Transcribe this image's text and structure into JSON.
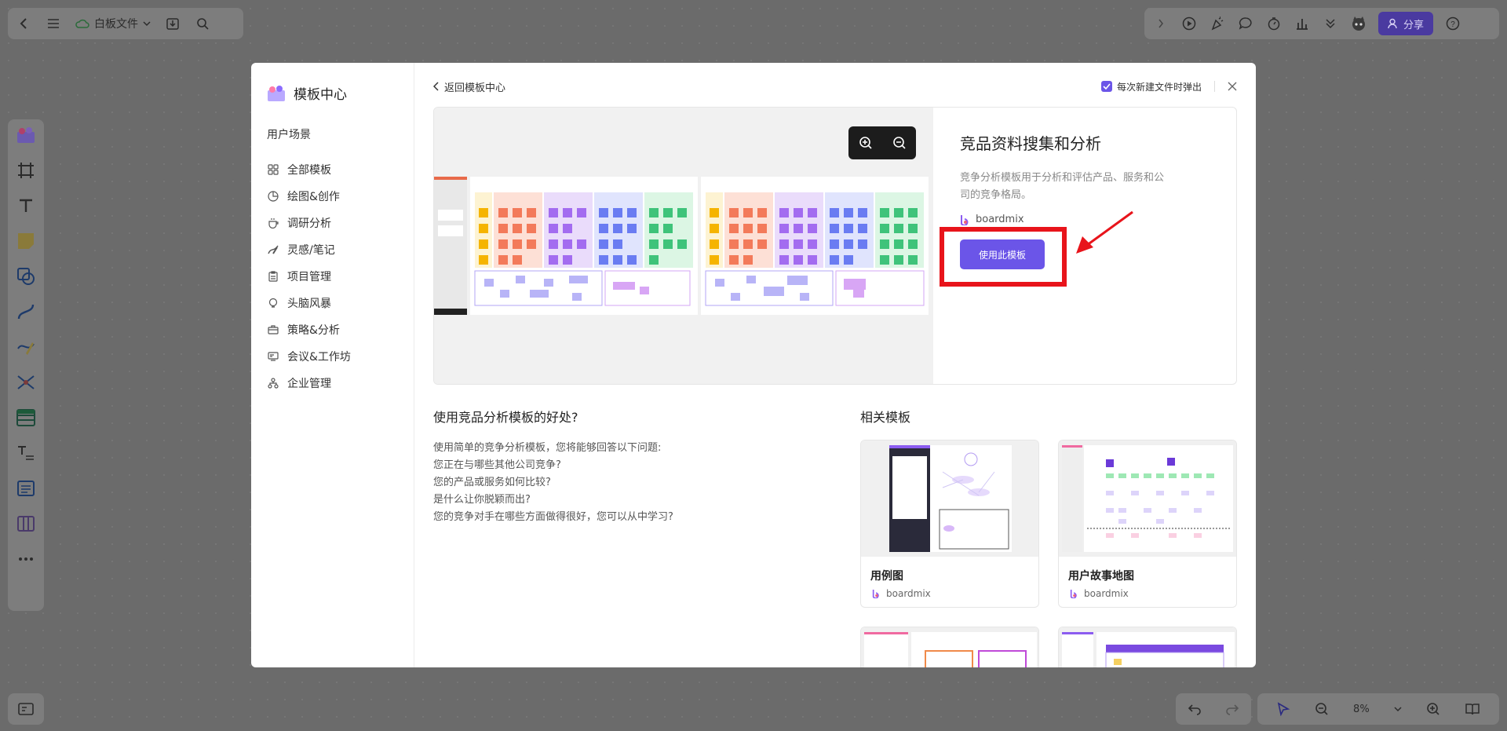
{
  "app": {
    "file_name": "白板文件",
    "share_label": "分享",
    "zoom_level": "8%"
  },
  "modal": {
    "brand_title": "模板中心",
    "side_group": "用户场景",
    "side_items": [
      {
        "label": "全部模板",
        "icon": "grid-icon"
      },
      {
        "label": "绘图&创作",
        "icon": "palette-icon"
      },
      {
        "label": "调研分析",
        "icon": "coffee-icon"
      },
      {
        "label": "灵感/笔记",
        "icon": "pen-icon"
      },
      {
        "label": "项目管理",
        "icon": "clipboard-icon"
      },
      {
        "label": "头脑风暴",
        "icon": "bulb-icon"
      },
      {
        "label": "策略&分析",
        "icon": "briefcase-icon"
      },
      {
        "label": "会议&工作坊",
        "icon": "meeting-icon"
      },
      {
        "label": "企业管理",
        "icon": "org-icon"
      }
    ],
    "back_label": "返回模板中心",
    "popup_checkbox_label": "每次新建文件时弹出",
    "template": {
      "title": "竞品资料搜集和分析",
      "description": "竞争分析模板用于分析和评估产品、服务和公司的竞争格局。",
      "author": "boardmix",
      "use_button": "使用此模板"
    },
    "benefits": {
      "title": "使用竞品分析模板的好处?",
      "lines": [
        "使用简单的竞争分析模板，您将能够回答以下问题:",
        "您正在与哪些其他公司竞争?",
        "您的产品或服务如何比较?",
        "是什么让你脱颖而出?",
        "您的竞争对手在哪些方面做得很好，您可以从中学习?"
      ]
    },
    "related": {
      "title": "相关模板",
      "cards": [
        {
          "name": "用例图",
          "author": "boardmix"
        },
        {
          "name": "用户故事地图",
          "author": "boardmix"
        }
      ]
    }
  },
  "colors": {
    "accent": "#6b55e8",
    "highlight": "#e8141b"
  }
}
